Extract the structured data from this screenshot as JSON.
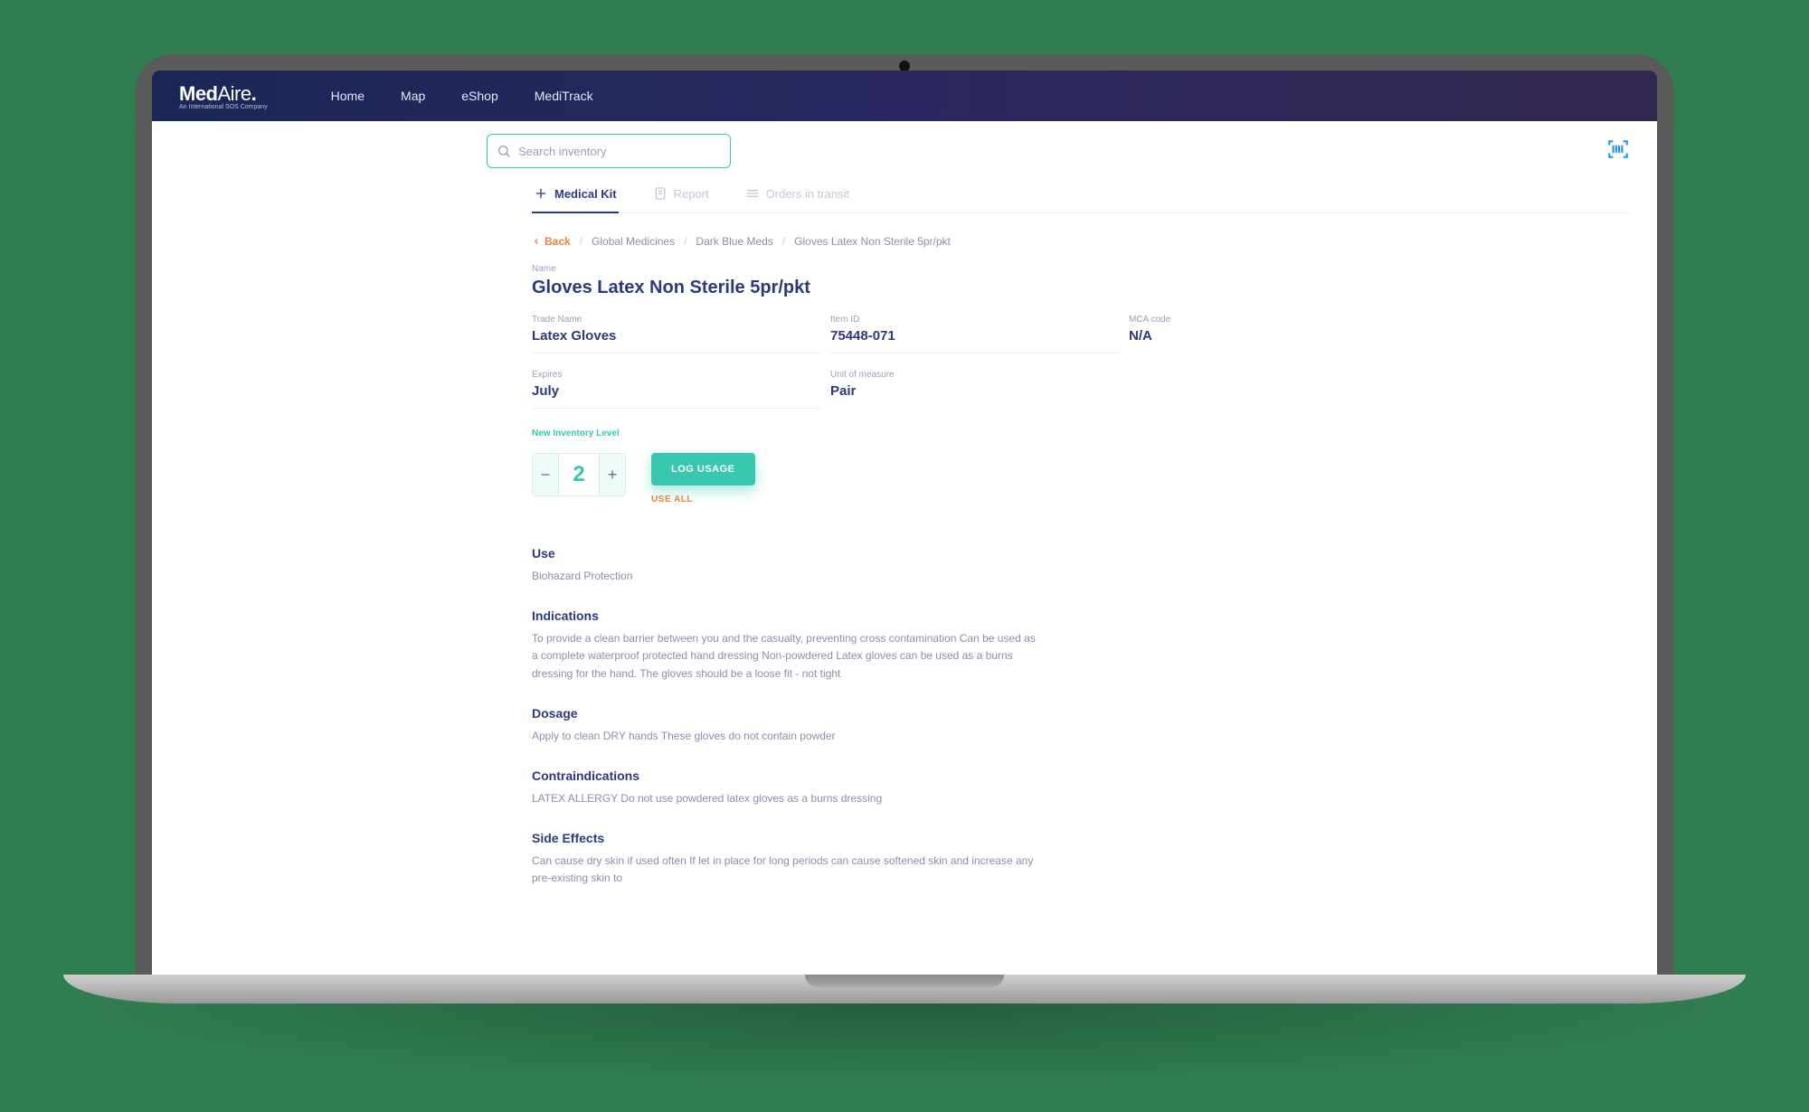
{
  "brand": {
    "name_bold": "Med",
    "name_light": "Aire",
    "sub": "An International SOS Company"
  },
  "nav": {
    "items": [
      "Home",
      "Map",
      "eShop",
      "MediTrack"
    ]
  },
  "search": {
    "placeholder": "Search inventory"
  },
  "tabs": [
    {
      "label": "Medical Kit",
      "active": true
    },
    {
      "label": "Report",
      "active": false
    },
    {
      "label": "Orders in transit",
      "active": false
    }
  ],
  "breadcrumb": {
    "back": "Back",
    "items": [
      "Global Medicines",
      "Dark Blue Meds",
      "Gloves Latex Non Sterile 5pr/pkt"
    ]
  },
  "item": {
    "name_label": "Name",
    "name": "Gloves Latex Non Sterile 5pr/pkt",
    "trade_name_label": "Trade Name",
    "trade_name": "Latex Gloves",
    "item_id_label": "Item ID",
    "item_id": "75448-071",
    "mca_label": "MCA code",
    "mca": "N/A",
    "expires_label": "Expires",
    "expires": "July",
    "uom_label": "Unit of measure",
    "uom": "Pair"
  },
  "inventory": {
    "label": "New Inventory Level",
    "count": "2",
    "log_button": "LOG USAGE",
    "use_all": "USE ALL"
  },
  "sections": {
    "use": {
      "title": "Use",
      "body": "Biohazard Protection"
    },
    "indications": {
      "title": "Indications",
      "body": "To provide a clean barrier between you and the casualty, preventing cross contamination Can be used as a complete waterproof protected hand dressing Non-powdered Latex gloves can be used as a burns dressing for the hand. The gloves should be a loose fit - not tight"
    },
    "dosage": {
      "title": "Dosage",
      "body": "Apply to clean DRY hands These gloves do not contain powder"
    },
    "contraindications": {
      "title": "Contraindications",
      "body": "LATEX ALLERGY Do not use powdered latex gloves as a burns dressing"
    },
    "side_effects": {
      "title": "Side Effects",
      "body": "Can cause dry skin if used often If let in place for long periods can cause softened skin and increase any pre-existing skin to"
    }
  }
}
